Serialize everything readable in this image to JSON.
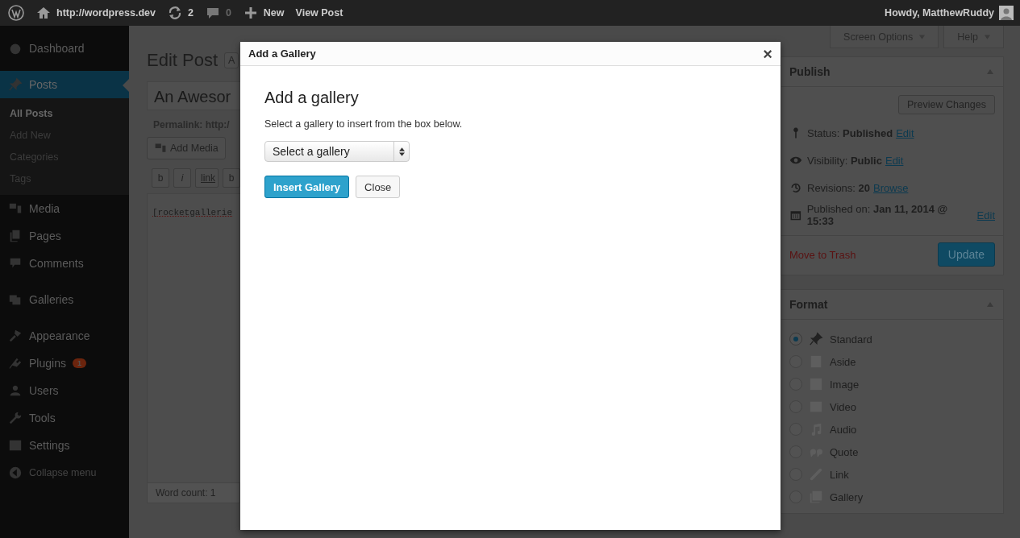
{
  "admin_bar": {
    "site": "http://wordpress.dev",
    "updates": "2",
    "comments": "0",
    "new": "New",
    "view": "View Post",
    "greeting": "Howdy, MatthewRuddy"
  },
  "sidebar": {
    "items": [
      {
        "label": "Dashboard",
        "selected": false
      },
      {
        "label": "Posts",
        "selected": true,
        "children": [
          {
            "label": "All Posts",
            "selected": true
          },
          {
            "label": "Add New",
            "selected": false
          },
          {
            "label": "Categories",
            "selected": false
          },
          {
            "label": "Tags",
            "selected": false
          }
        ]
      },
      {
        "label": "Media",
        "selected": false
      },
      {
        "label": "Pages",
        "selected": false
      },
      {
        "label": "Comments",
        "selected": false
      },
      {
        "label": "Galleries",
        "selected": false
      },
      {
        "label": "Appearance",
        "selected": false
      },
      {
        "label": "Plugins",
        "selected": false,
        "badge": "1"
      },
      {
        "label": "Users",
        "selected": false
      },
      {
        "label": "Tools",
        "selected": false
      },
      {
        "label": "Settings",
        "selected": false
      }
    ],
    "collapse": "Collapse menu"
  },
  "screen_tabs": [
    "Screen Options",
    "Help"
  ],
  "page_title": "Edit Post",
  "add_new_button": "A",
  "post_title": "An Awesor",
  "permalink_label": "Permalink: http:/",
  "add_media": "Add Media",
  "editor_buttons": [
    "b",
    "i",
    "link",
    "b"
  ],
  "editor_text": "[rocketgallerie",
  "word_count": "Word count: 1",
  "publish": {
    "title": "Publish",
    "preview": "Preview Changes",
    "rows": [
      {
        "text": "Status: **Published**",
        "link": "Edit"
      },
      {
        "text": "Visibility: **Public**",
        "link": "Edit"
      },
      {
        "text": "Revisions: **20**",
        "link": "Browse"
      },
      {
        "text": "Published on: **Jan 11, 2014 @ 15:33**",
        "link": "Edit"
      }
    ],
    "trash": "Move to Trash",
    "update": "Update"
  },
  "format": {
    "title": "Format",
    "options": [
      {
        "label": "Standard",
        "selected": true
      },
      {
        "label": "Aside",
        "selected": false
      },
      {
        "label": "Image",
        "selected": false
      },
      {
        "label": "Video",
        "selected": false
      },
      {
        "label": "Audio",
        "selected": false
      },
      {
        "label": "Quote",
        "selected": false
      },
      {
        "label": "Link",
        "selected": false
      },
      {
        "label": "Gallery",
        "selected": false
      }
    ]
  },
  "modal": {
    "title": "Add a Gallery",
    "close": "×",
    "heading": "Add a gallery",
    "description": "Select a gallery to insert from the box below.",
    "select": {
      "value": "Select a gallery"
    },
    "buttons": [
      {
        "label": "Insert Gallery",
        "kind": "primary"
      },
      {
        "label": "Close",
        "kind": "secondary"
      }
    ]
  }
}
